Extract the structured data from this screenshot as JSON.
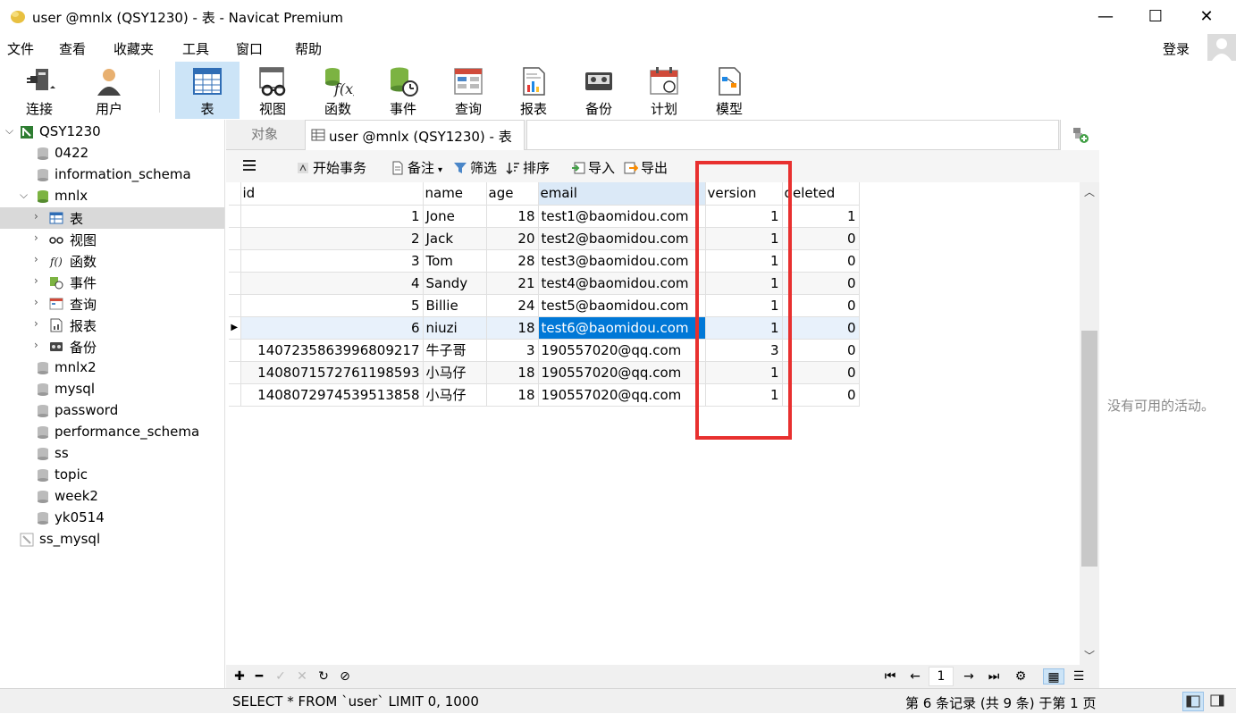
{
  "window": {
    "title": "user @mnlx (QSY1230) - 表 - Navicat Premium",
    "minimize": "—",
    "maximize": "☐",
    "close": "✕"
  },
  "menu": [
    "文件",
    "查看",
    "收藏夹",
    "工具",
    "窗口",
    "帮助"
  ],
  "login": "登录",
  "toolbar": [
    {
      "label": "连接",
      "icon": "plug-icon"
    },
    {
      "label": "用户",
      "icon": "user-icon"
    },
    {
      "label": "表",
      "icon": "table-icon"
    },
    {
      "label": "视图",
      "icon": "view-icon"
    },
    {
      "label": "函数",
      "icon": "function-icon"
    },
    {
      "label": "事件",
      "icon": "event-icon"
    },
    {
      "label": "查询",
      "icon": "query-icon"
    },
    {
      "label": "报表",
      "icon": "report-icon"
    },
    {
      "label": "备份",
      "icon": "backup-icon"
    },
    {
      "label": "计划",
      "icon": "schedule-icon"
    },
    {
      "label": "模型",
      "icon": "model-icon"
    }
  ],
  "tree": [
    {
      "label": "QSY1230",
      "level": 0,
      "expanded": true,
      "type": "connection"
    },
    {
      "label": "0422",
      "level": 1,
      "type": "database"
    },
    {
      "label": "information_schema",
      "level": 1,
      "type": "database"
    },
    {
      "label": "mnlx",
      "level": 1,
      "expanded": true,
      "type": "database-open"
    },
    {
      "label": "表",
      "level": 2,
      "type": "tables",
      "selected": true
    },
    {
      "label": "视图",
      "level": 2,
      "type": "views"
    },
    {
      "label": "函数",
      "level": 2,
      "type": "functions"
    },
    {
      "label": "事件",
      "level": 2,
      "type": "events"
    },
    {
      "label": "查询",
      "level": 2,
      "type": "queries"
    },
    {
      "label": "报表",
      "level": 2,
      "type": "reports"
    },
    {
      "label": "备份",
      "level": 2,
      "type": "backups"
    },
    {
      "label": "mnlx2",
      "level": 1,
      "type": "database"
    },
    {
      "label": "mysql",
      "level": 1,
      "type": "database"
    },
    {
      "label": "password",
      "level": 1,
      "type": "database"
    },
    {
      "label": "performance_schema",
      "level": 1,
      "type": "database"
    },
    {
      "label": "ss",
      "level": 1,
      "type": "database"
    },
    {
      "label": "topic",
      "level": 1,
      "type": "database"
    },
    {
      "label": "week2",
      "level": 1,
      "type": "database"
    },
    {
      "label": "yk0514",
      "level": 1,
      "type": "database"
    },
    {
      "label": "ss_mysql",
      "level": 0,
      "type": "connection-closed"
    }
  ],
  "tabs": {
    "objects": "对象",
    "active": "user @mnlx (QSY1230) - 表"
  },
  "subtoolbar": {
    "begin_transaction": "开始事务",
    "note": "备注",
    "filter": "筛选",
    "sort": "排序",
    "import": "导入",
    "export": "导出"
  },
  "grid": {
    "columns": [
      "id",
      "name",
      "age",
      "email",
      "version",
      "deleted"
    ],
    "rows": [
      [
        "1",
        "Jone",
        "18",
        "test1@baomidou.com",
        "1",
        "1"
      ],
      [
        "2",
        "Jack",
        "20",
        "test2@baomidou.com",
        "1",
        "0"
      ],
      [
        "3",
        "Tom",
        "28",
        "test3@baomidou.com",
        "1",
        "0"
      ],
      [
        "4",
        "Sandy",
        "21",
        "test4@baomidou.com",
        "1",
        "0"
      ],
      [
        "5",
        "Billie",
        "24",
        "test5@baomidou.com",
        "1",
        "0"
      ],
      [
        "6",
        "niuzi",
        "18",
        "test6@baomidou.com",
        "1",
        "0"
      ],
      [
        "1407235863996809217",
        "牛子哥",
        "3",
        "190557020@qq.com",
        "3",
        "0"
      ],
      [
        "1408071572761198593",
        "小马仔",
        "18",
        "190557020@qq.com",
        "1",
        "0"
      ],
      [
        "1408072974539513858",
        "小马仔",
        "18",
        "190557020@qq.com",
        "1",
        "0"
      ]
    ],
    "current_row": 5,
    "selected_column": 3,
    "highlight_color": "#e8302f"
  },
  "right_panel": {
    "message": "没有可用的活动。"
  },
  "pager": {
    "page": "1"
  },
  "status": {
    "sql": "SELECT * FROM `user` LIMIT 0, 1000",
    "records": "第 6 条记录 (共 9 条) 于第 1 页"
  }
}
